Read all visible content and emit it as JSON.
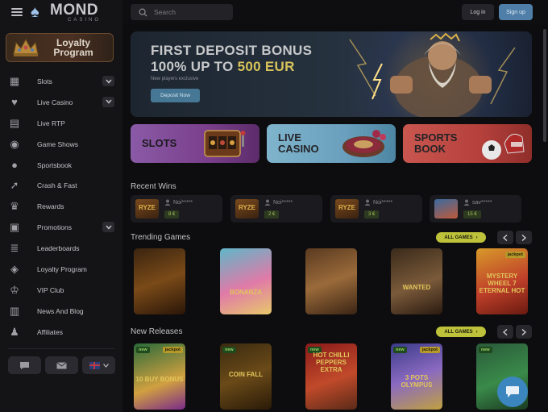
{
  "brand": {
    "name": "MOND",
    "sub": "CASINO"
  },
  "header": {
    "search_placeholder": "Search",
    "login": "Log in",
    "signup": "Sign up"
  },
  "sidebar": {
    "loyalty_banner": "Loyalty Program",
    "items": [
      {
        "label": "Slots",
        "icon": "slots-icon",
        "expandable": true
      },
      {
        "label": "Live Casino",
        "icon": "live-casino-icon",
        "expandable": true
      },
      {
        "label": "Live RTP",
        "icon": "rtp-icon",
        "expandable": false
      },
      {
        "label": "Game Shows",
        "icon": "game-shows-icon",
        "expandable": false
      },
      {
        "label": "Sportsbook",
        "icon": "soccer-ball-icon",
        "expandable": false
      },
      {
        "label": "Crash & Fast",
        "icon": "rocket-icon",
        "expandable": false
      },
      {
        "label": "Rewards",
        "icon": "trophy-icon",
        "expandable": false
      },
      {
        "label": "Promotions",
        "icon": "gift-icon",
        "expandable": true
      },
      {
        "label": "Leaderboards",
        "icon": "leaderboard-icon",
        "expandable": false
      },
      {
        "label": "Loyalty Program",
        "icon": "loyalty-icon",
        "expandable": false
      },
      {
        "label": "VIP Club",
        "icon": "crown-icon",
        "expandable": false
      },
      {
        "label": "News And Blog",
        "icon": "news-icon",
        "expandable": false
      },
      {
        "label": "Affiliates",
        "icon": "affiliates-icon",
        "expandable": false
      }
    ]
  },
  "hero": {
    "title_line1": "FIRST DEPOSIT BONUS",
    "title_line2_prefix": "100% UP TO ",
    "title_line2_highlight": "500 EUR",
    "subtitle": "New players exclusive",
    "cta": "Deposit Now"
  },
  "categories": [
    {
      "line1": "SLOTS",
      "line2": ""
    },
    {
      "line1": "LIVE",
      "line2": "CASINO"
    },
    {
      "line1": "SPORTS",
      "line2": "BOOK"
    }
  ],
  "recent_wins": {
    "title": "Recent Wins",
    "items": [
      {
        "game": "RYZE",
        "user": "Noi*****",
        "amount": "8 €"
      },
      {
        "game": "RYZE",
        "user": "Noi*****",
        "amount": "2 €"
      },
      {
        "game": "RYZE",
        "user": "Noi*****",
        "amount": "3 €"
      },
      {
        "game": "",
        "user": "sav*****",
        "amount": "15 €"
      }
    ]
  },
  "trending": {
    "title": "Trending Games",
    "all_games": "ALL GAMES",
    "games": [
      {
        "title": "",
        "badge_new": false,
        "badge_jackpot": false
      },
      {
        "title": "BONANZA",
        "badge_new": false,
        "badge_jackpot": false
      },
      {
        "title": "",
        "badge_new": false,
        "badge_jackpot": false
      },
      {
        "title": "WANTED",
        "badge_new": false,
        "badge_jackpot": false
      },
      {
        "title": "MYSTERY WHEEL 7 ETERNAL HOT",
        "badge_new": false,
        "badge_jackpot": true
      }
    ]
  },
  "new_releases": {
    "title": "New Releases",
    "all_games": "ALL GAMES",
    "games": [
      {
        "title": "10 BUY BONUS",
        "badge_new": true,
        "badge_jackpot": true
      },
      {
        "title": "COIN FALL",
        "badge_new": true,
        "badge_jackpot": false
      },
      {
        "title": "HOT CHILLI PEPPERS EXTRA",
        "badge_new": true,
        "badge_jackpot": false
      },
      {
        "title": "3 POTS OLYMPUS",
        "badge_new": true,
        "badge_jackpot": true
      },
      {
        "title": "",
        "badge_new": true,
        "badge_jackpot": false
      }
    ]
  },
  "badges": {
    "new": "new",
    "jackpot": "jackpot"
  },
  "colors": {
    "accent": "#bdc23a",
    "signup": "#4f7fa8",
    "hero_highlight": "#d8c35a"
  }
}
